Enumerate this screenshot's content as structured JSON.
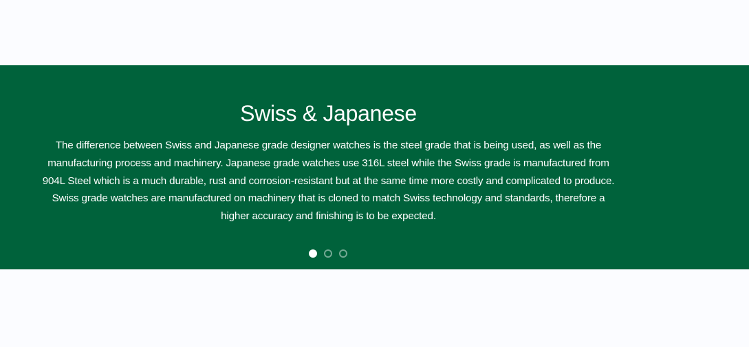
{
  "slider": {
    "title": "Swiss & Japanese",
    "text": "The difference between Swiss and Japanese grade designer watches is the steel grade that is being used, as well as the manufacturing process and machinery. Japanese grade watches use 316L steel while the Swiss grade is manufactured from 904L Steel which is a much durable, rust and corrosion-resistant but at the same time more costly and complicated to produce. Swiss grade watches are manufactured on machinery that is cloned to match Swiss technology and standards, therefore a higher accuracy and finishing is to be expected.",
    "dots": [
      "active",
      "inactive",
      "inactive"
    ],
    "colors": {
      "band": "#00623b",
      "text": "#ffffff",
      "page": "#fbfcff"
    }
  }
}
